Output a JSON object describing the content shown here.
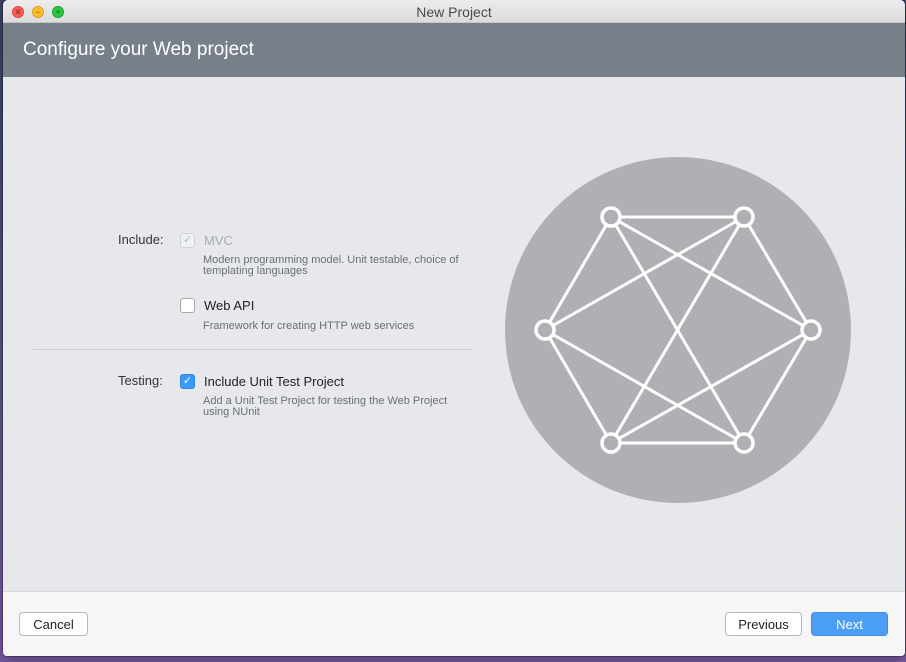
{
  "window": {
    "title": "New Project"
  },
  "header": {
    "title": "Configure your Web project"
  },
  "include": {
    "label": "Include:",
    "mvc": {
      "label": "MVC",
      "checked": true,
      "enabled": false,
      "description": "Modern programming model. Unit testable, choice of templating languages"
    },
    "webapi": {
      "label": "Web API",
      "checked": false,
      "enabled": true,
      "description": "Framework for creating HTTP web services"
    }
  },
  "testing": {
    "label": "Testing:",
    "unit_test": {
      "label": "Include Unit Test Project",
      "checked": true,
      "enabled": true,
      "description": "Add a Unit Test Project for testing the Web Project using NUnit"
    }
  },
  "footer": {
    "cancel_label": "Cancel",
    "previous_label": "Previous",
    "next_label": "Next"
  },
  "colors": {
    "header_bg": "#778089",
    "accent": "#4a9ef5",
    "graphic_circle": "#aeb0b3"
  },
  "icons": {
    "graphic": "network-graph-icon",
    "checkmark": "checkmark-icon"
  }
}
